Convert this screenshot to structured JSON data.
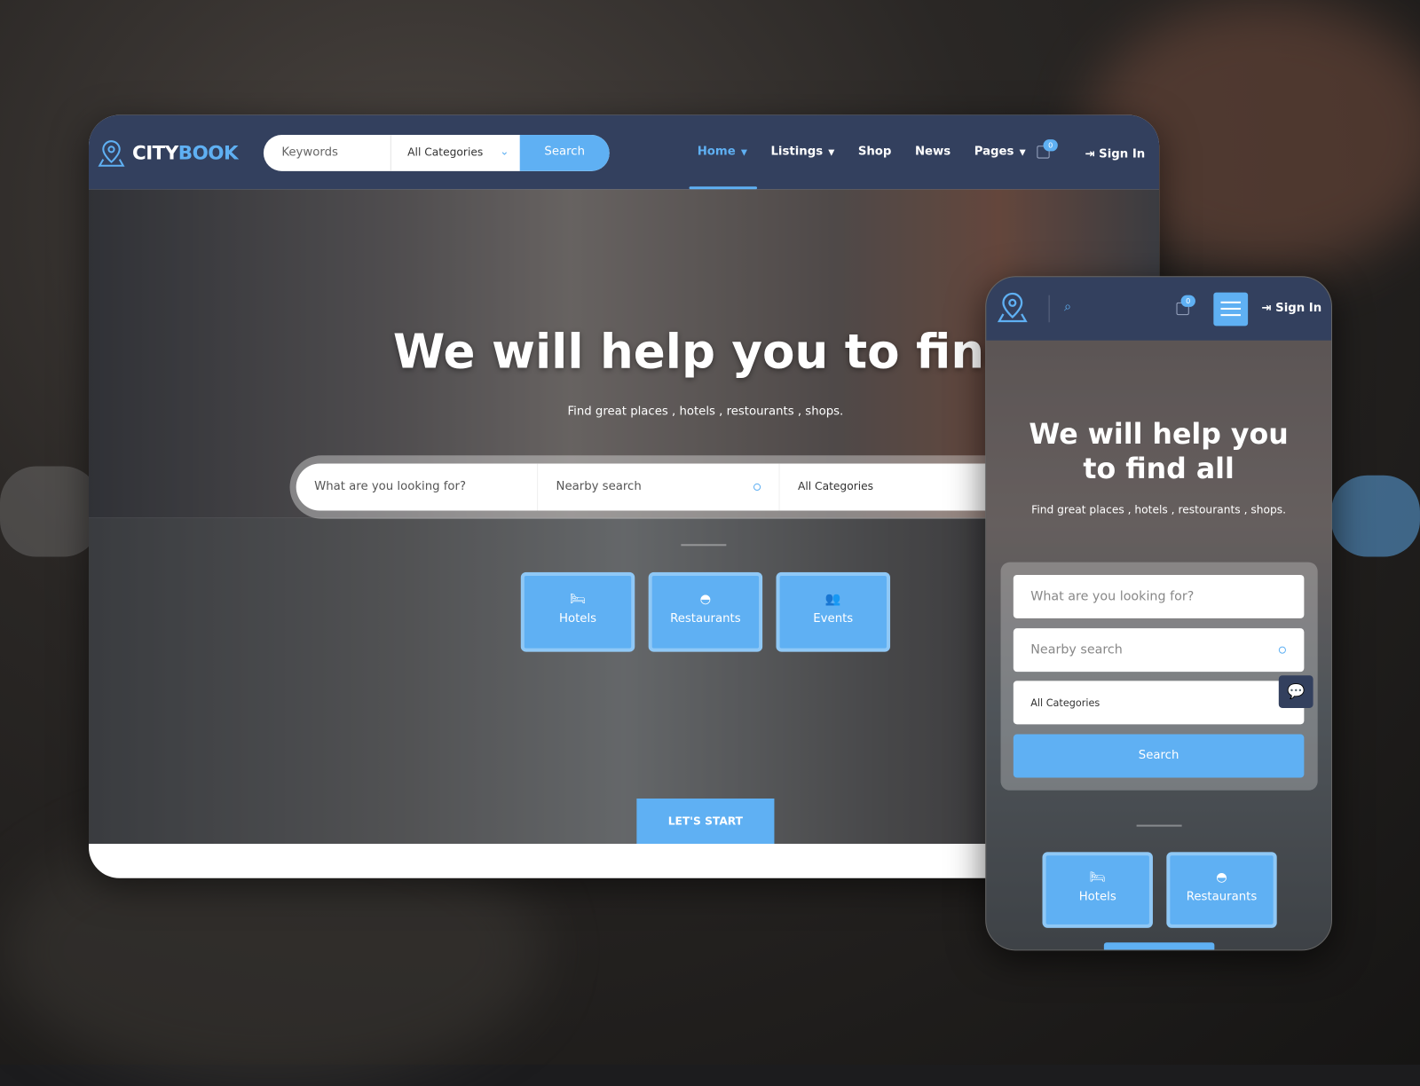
{
  "brand": {
    "part1": "CITY",
    "part2": "BOOK"
  },
  "header": {
    "keywords_placeholder": "Keywords",
    "category": "All Categories",
    "search_label": "Search",
    "menu": [
      {
        "label": "Home",
        "caret": true,
        "active": true
      },
      {
        "label": "Listings",
        "caret": true
      },
      {
        "label": "Shop"
      },
      {
        "label": "News"
      },
      {
        "label": "Pages",
        "caret": true
      }
    ],
    "cart_count": "0",
    "signin": "Sign In"
  },
  "hero": {
    "title": "We will help you to find a",
    "subtitle": "Find great places , hotels , restourants , shops.",
    "search_placeholder": "What are you looking for?",
    "nearby_placeholder": "Nearby search",
    "category": "All Categories",
    "categories": [
      {
        "icon": "bed-icon",
        "label": "Hotels"
      },
      {
        "icon": "cloche-icon",
        "label": "Restaurants"
      },
      {
        "icon": "users-icon",
        "label": "Events"
      }
    ],
    "start_label": "LET'S START"
  },
  "mobile": {
    "cart_count": "0",
    "signin": "Sign In",
    "title": "We will help you to find all",
    "subtitle": "Find great places , hotels , restourants , shops.",
    "search_placeholder": "What are you looking for?",
    "nearby_placeholder": "Nearby search",
    "category": "All Categories",
    "search_label": "Search",
    "categories": [
      {
        "icon": "bed-icon",
        "label": "Hotels"
      },
      {
        "icon": "cloche-icon",
        "label": "Restaurants"
      }
    ]
  },
  "colors": {
    "accent": "#5fb0f3",
    "navbar": "#33405e"
  }
}
